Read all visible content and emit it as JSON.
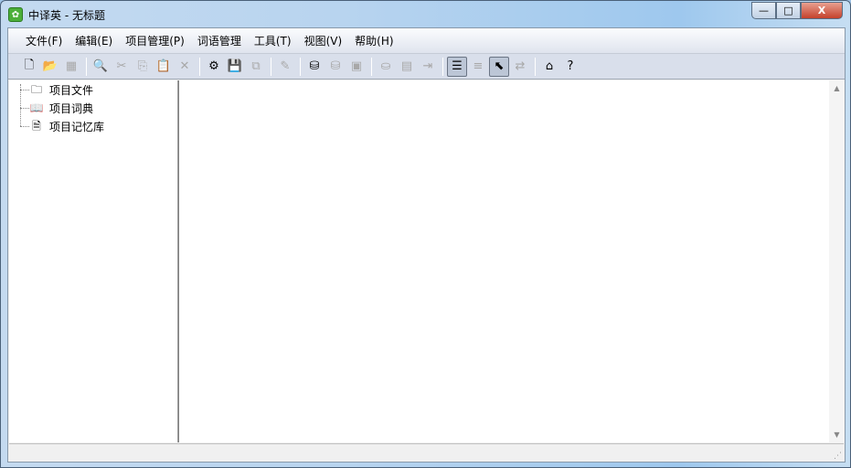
{
  "window": {
    "title": "中译英 - 无标题",
    "app_icon": "app-logo-icon",
    "controls": {
      "minimize": "—",
      "maximize": "□",
      "close": "X"
    }
  },
  "menu": [
    "文件(F)",
    "编辑(E)",
    "项目管理(P)",
    "词语管理",
    "工具(T)",
    "视图(V)",
    "帮助(H)"
  ],
  "toolbar": [
    {
      "icon": "new-file-icon",
      "glyph": "🗋",
      "state": "enabled"
    },
    {
      "icon": "open-folder-icon",
      "glyph": "📂",
      "state": "enabled"
    },
    {
      "icon": "save-icon",
      "glyph": "▦",
      "state": "disabled"
    },
    {
      "sep": true
    },
    {
      "icon": "find-icon",
      "glyph": "🔍",
      "state": "disabled"
    },
    {
      "icon": "cut-icon",
      "glyph": "✂",
      "state": "disabled"
    },
    {
      "icon": "copy-icon",
      "glyph": "⎘",
      "state": "disabled"
    },
    {
      "icon": "paste-icon",
      "glyph": "📋",
      "state": "disabled"
    },
    {
      "icon": "delete-icon",
      "glyph": "✕",
      "state": "disabled"
    },
    {
      "sep": true
    },
    {
      "icon": "project-settings-icon",
      "glyph": "⚙",
      "state": "enabled"
    },
    {
      "icon": "save-project-icon",
      "glyph": "💾",
      "state": "enabled"
    },
    {
      "icon": "export-project-icon",
      "glyph": "⧉",
      "state": "disabled"
    },
    {
      "sep": true
    },
    {
      "icon": "edit-document-icon",
      "glyph": "✎",
      "state": "disabled"
    },
    {
      "sep": true
    },
    {
      "icon": "translate-icon",
      "glyph": "⛁",
      "state": "enabled"
    },
    {
      "icon": "translate-settings-icon",
      "glyph": "⛁",
      "state": "disabled"
    },
    {
      "icon": "clipboard-icon",
      "glyph": "▣",
      "state": "disabled"
    },
    {
      "sep": true
    },
    {
      "icon": "database-icon",
      "glyph": "⛀",
      "state": "disabled"
    },
    {
      "icon": "table-icon",
      "glyph": "▤",
      "state": "disabled"
    },
    {
      "icon": "import-icon",
      "glyph": "⇥",
      "state": "disabled"
    },
    {
      "sep": true
    },
    {
      "icon": "tree-view-icon",
      "glyph": "☰",
      "state": "active"
    },
    {
      "icon": "list-view-icon",
      "glyph": "≡",
      "state": "disabled"
    },
    {
      "icon": "pointer-ruler-icon",
      "glyph": "⬉",
      "state": "active"
    },
    {
      "icon": "align-icon",
      "glyph": "⇄",
      "state": "disabled"
    },
    {
      "sep": true
    },
    {
      "icon": "home-icon",
      "glyph": "⌂",
      "state": "enabled"
    },
    {
      "icon": "help-icon",
      "glyph": "?",
      "state": "enabled"
    }
  ],
  "tree": [
    {
      "label": "项目文件",
      "icon": "folder-icon",
      "glyph": "🗀"
    },
    {
      "label": "项目词典",
      "icon": "dictionary-book-icon",
      "glyph": "📖"
    },
    {
      "label": "项目记忆库",
      "icon": "memory-database-icon",
      "glyph": "🗎"
    }
  ]
}
